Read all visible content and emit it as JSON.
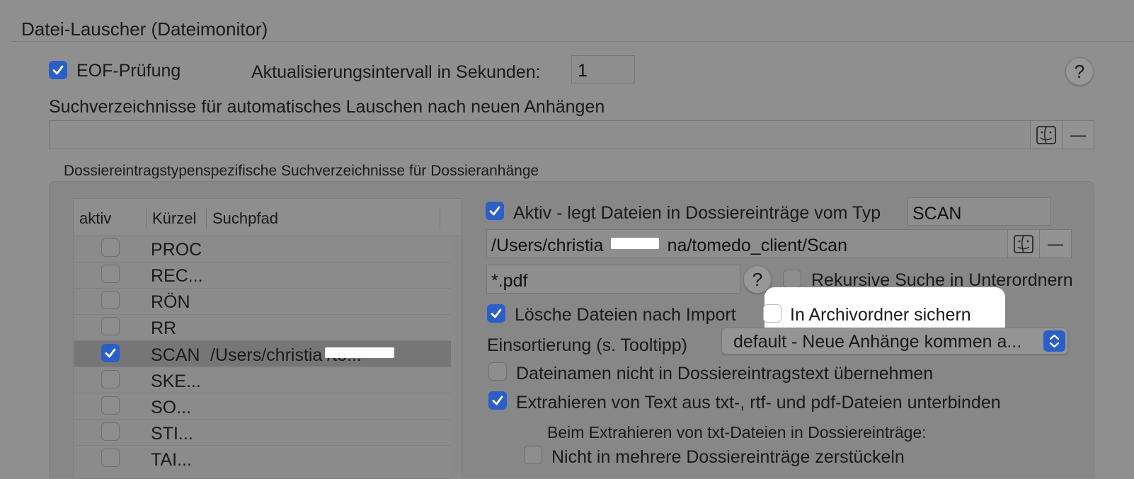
{
  "section": {
    "title": "Datei-Lauscher (Dateimonitor)"
  },
  "eof": {
    "label": "EOF-Prüfung",
    "checked": true
  },
  "interval": {
    "label": "Aktualisierungsintervall in Sekunden:",
    "value": "1"
  },
  "help": {
    "symbol": "?"
  },
  "search_dirs": {
    "label": "Suchverzeichnisse für automatisches Lauschen nach neuen Anhängen",
    "value": ""
  },
  "buttons": {
    "remove_symbol": "—"
  },
  "dossier": {
    "title": "Dossiereintragstypenspezifische Suchverzeichnisse für Dossieranhänge"
  },
  "table": {
    "headers": {
      "active": "aktiv",
      "short": "Kürzel",
      "path": "Suchpfad"
    },
    "rows": [
      {
        "short": "PROC",
        "path": "",
        "checked": false,
        "selected": false
      },
      {
        "short": "REC...",
        "path": "",
        "checked": false,
        "selected": false
      },
      {
        "short": "RÖN",
        "path": "",
        "checked": false,
        "selected": false
      },
      {
        "short": "RR",
        "path": "",
        "checked": false,
        "selected": false
      },
      {
        "short": "SCAN",
        "path": "/Users/christia            /to...",
        "checked": true,
        "selected": true
      },
      {
        "short": "SKE...",
        "path": "",
        "checked": false,
        "selected": false
      },
      {
        "short": "SO...",
        "path": "",
        "checked": false,
        "selected": false
      },
      {
        "short": "STI...",
        "path": "",
        "checked": false,
        "selected": false
      },
      {
        "short": "TAI...",
        "path": "",
        "checked": false,
        "selected": false
      }
    ]
  },
  "detail": {
    "active_label": "Aktiv - legt Dateien in Dossiereinträge vom Typ",
    "active_checked": true,
    "type_value": "SCAN",
    "path_value": "/Users/christia             na/tomedo_client/Scan",
    "filter_value": "*.pdf",
    "recursive_label": "Rekursive Suche in Unterordnern",
    "recursive_checked": false,
    "delete_label": "Lösche Dateien nach Import",
    "delete_checked": true,
    "archive_label": "In Archivordner sichern",
    "archive_checked": false,
    "sort_label": "Einsortierung (s. Tooltipp)",
    "sort_value": "default - Neue Anhänge kommen a...",
    "no_filename_label": "Dateinamen nicht in Dossiereintragstext übernehmen",
    "no_filename_checked": false,
    "no_extract_label": "Extrahieren von Text aus txt-, rtf- und pdf-Dateien unterbinden",
    "no_extract_checked": true,
    "txt_heading": "Beim Extrahieren von txt-Dateien in Dossiereinträge:",
    "no_split_label": "Nicht in mehrere Dossiereinträge zerstückeln",
    "no_split_checked": false
  }
}
